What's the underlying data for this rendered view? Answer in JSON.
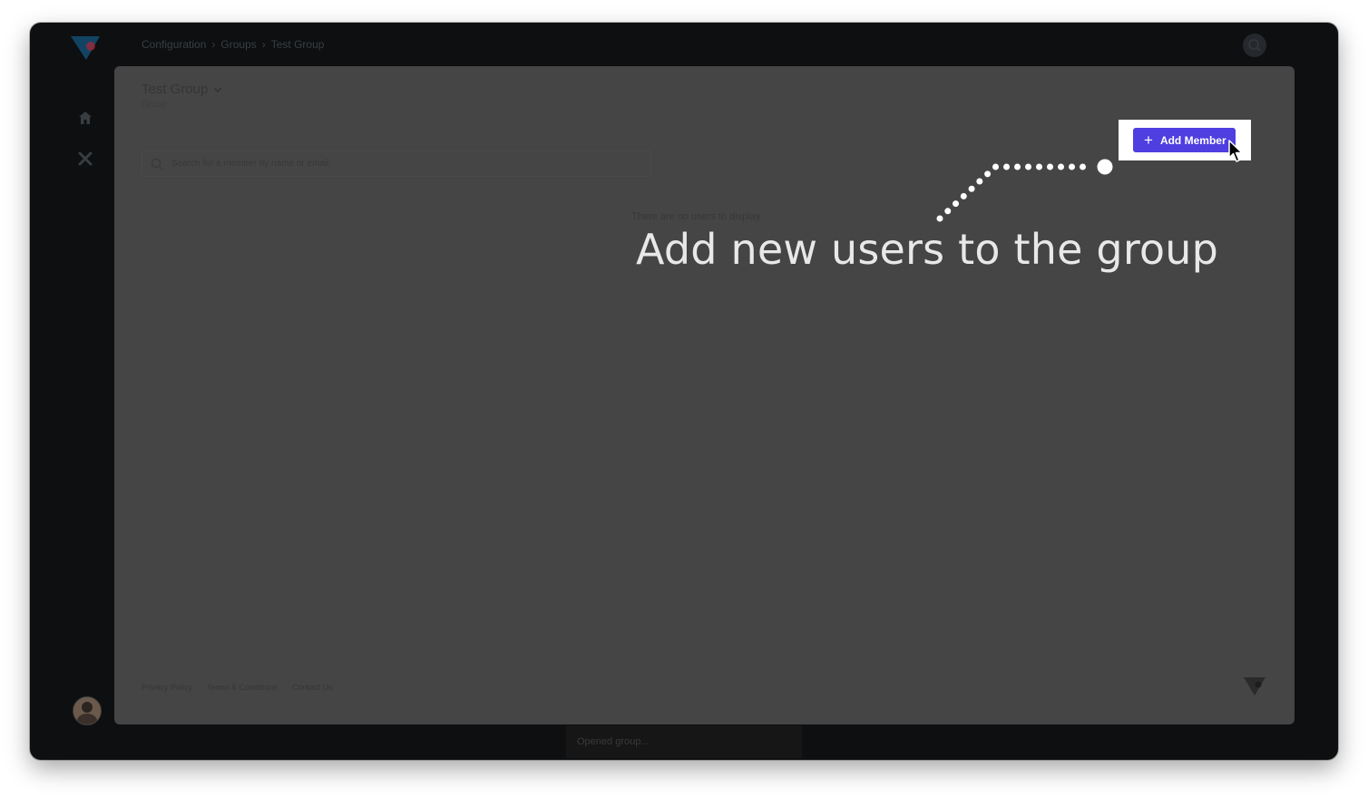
{
  "breadcrumb": {
    "items": [
      "Configuration",
      "Groups",
      "Test Group"
    ]
  },
  "group": {
    "title": "Test Group",
    "subtitle": "Group"
  },
  "search": {
    "placeholder": "Search for a member by name or email"
  },
  "empty_state": "There are no users to display.",
  "add_member_button": "Add Member",
  "callout": "Add new users to the group",
  "footer": {
    "links": [
      "Privacy Policy",
      "Terms & Conditions",
      "Contact Us"
    ]
  },
  "toast": "Opened group...",
  "colors": {
    "accent": "#4f3ee0",
    "logo_blue": "#1a6fa8",
    "logo_red": "#c8212e",
    "panel": "#454545",
    "frame": "#0d0f11"
  },
  "icons": [
    "app-logo-icon",
    "home-icon",
    "tools-icon",
    "search-icon",
    "chevron-down-icon",
    "plus-icon",
    "cursor-icon"
  ]
}
